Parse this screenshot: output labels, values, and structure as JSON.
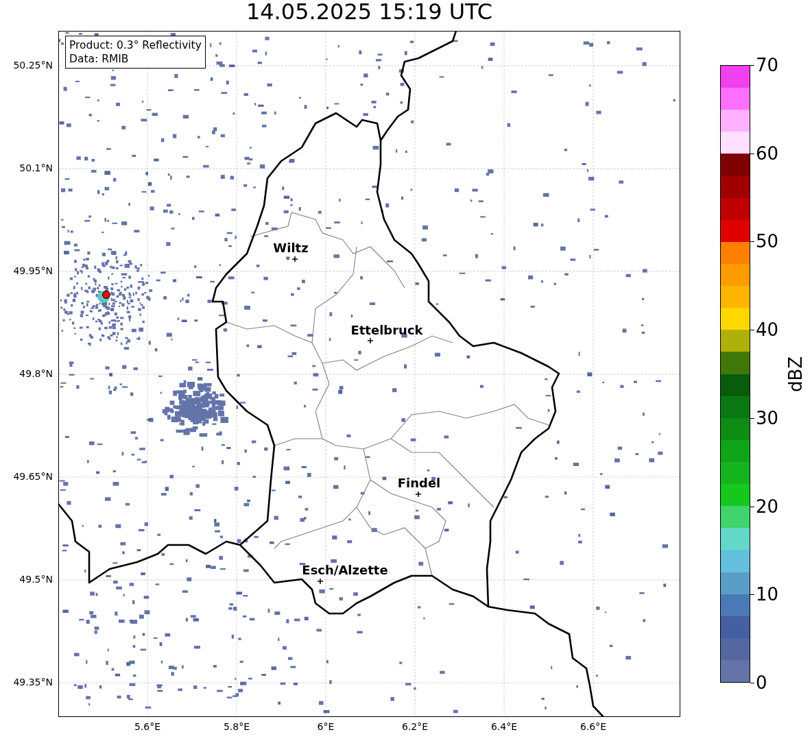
{
  "title": "14.05.2025 15:19 UTC",
  "info_box": {
    "lines": [
      "Product: 0.3° Reflectivity",
      "Data: RMIB"
    ]
  },
  "lat_labels": [
    "50.25°N",
    "50.1°N",
    "49.95°N",
    "49.8°N",
    "49.65°N",
    "49.5°N",
    "49.35°N"
  ],
  "lon_labels": [
    "5.6°E",
    "5.8°E",
    "6°E",
    "6.2°E",
    "6.4°E",
    "6.6°E"
  ],
  "cities": [
    {
      "name": "Wiltz"
    },
    {
      "name": "Ettelbruck"
    },
    {
      "name": "Findel"
    },
    {
      "name": "Esch/Alzette"
    }
  ],
  "colorbar": {
    "label": "dBZ",
    "ticks": [
      "70",
      "60",
      "50",
      "40",
      "30",
      "20",
      "10",
      "0"
    ],
    "bins": [
      {
        "color": "#6474a8"
      },
      {
        "color": "#5467a0"
      },
      {
        "color": "#445fa3"
      },
      {
        "color": "#4a7ab5"
      },
      {
        "color": "#5a9ec8"
      },
      {
        "color": "#64c0dc"
      },
      {
        "color": "#64d8c8"
      },
      {
        "color": "#40d46c"
      },
      {
        "color": "#14c81e"
      },
      {
        "color": "#14b41e"
      },
      {
        "color": "#10a418"
      },
      {
        "color": "#0e8c16"
      },
      {
        "color": "#0a7812"
      },
      {
        "color": "#085c0c"
      },
      {
        "color": "#42780a"
      },
      {
        "color": "#b0b00a"
      },
      {
        "color": "#ffd800"
      },
      {
        "color": "#ffb400"
      },
      {
        "color": "#ff9c00"
      },
      {
        "color": "#ff8000"
      },
      {
        "color": "#e00000"
      },
      {
        "color": "#c00000"
      },
      {
        "color": "#a00000"
      },
      {
        "color": "#800000"
      },
      {
        "color": "#ffe0ff"
      },
      {
        "color": "#ffb0ff"
      },
      {
        "color": "#ff70ff"
      },
      {
        "color": "#f040f0"
      }
    ]
  }
}
